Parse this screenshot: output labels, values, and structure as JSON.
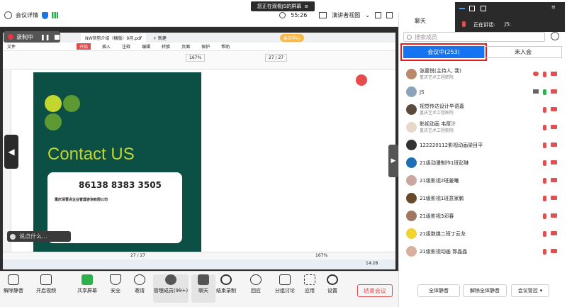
{
  "banner": {
    "text": "您正在观看JS的屏幕"
  },
  "topbar": {
    "meeting_info": "会议详情",
    "time": "55:26",
    "view": "演讲者视图"
  },
  "record": {
    "label": "录制中"
  },
  "pdf": {
    "tab": "NW快剪介绍（横版）9月.pdf",
    "new_tab": "+ 新建",
    "vip": "会员中心",
    "menus": [
      "文件",
      "开始",
      "插入",
      "注释",
      "编辑",
      "转换",
      "页面",
      "保护",
      "帮助"
    ],
    "page": "27 / 27",
    "zoom": "167%",
    "page_bottom": "27 / 27",
    "zoom_bottom": "167%"
  },
  "slide": {
    "title": "Contact US",
    "phone": "86138 8383 3505",
    "company": "重庆深晋点企业管理咨询有限公司"
  },
  "say": {
    "placeholder": "说点什么..."
  },
  "taskbar": {
    "time": "14:28"
  },
  "toolbar": {
    "items": [
      "解除静音",
      "开启视频",
      "共享屏幕",
      "安全",
      "邀请",
      "管理成员(99+)",
      "聊天",
      "结束录制",
      "回应",
      "分组讨论",
      "应用",
      "设置"
    ],
    "end": "结束会议"
  },
  "panel": {
    "chat": "聊天",
    "search": "搜索成员",
    "tab_in": "会议中(253)",
    "tab_out": "未入会",
    "members": [
      {
        "name": "张嘉悦(主持人, 我)",
        "org": "重庆艺术工程职院"
      },
      {
        "name": "JS",
        "org": ""
      },
      {
        "name": "视觉传达设计毕语嘉",
        "org": "重庆艺术工程职院"
      },
      {
        "name": "影视动画 韦厚汁",
        "org": "重庆艺术工程职院"
      },
      {
        "name": "122220112影视动画梁目平",
        "org": ""
      },
      {
        "name": "21级动漫制作1班彭琳",
        "org": ""
      },
      {
        "name": "21级影视2班姜曦",
        "org": ""
      },
      {
        "name": "21级影视1班意家鹏",
        "org": ""
      },
      {
        "name": "21级影视3邓春",
        "org": ""
      },
      {
        "name": "21级数媒二班丁云龙",
        "org": ""
      },
      {
        "name": "21级影视动画 郭晶晶",
        "org": ""
      }
    ],
    "mute_all": "全体静音",
    "unmute_all": "解除全体静音",
    "manage": "会议管控"
  },
  "speaker": {
    "label": "正在讲话:",
    "name": "JS;"
  }
}
